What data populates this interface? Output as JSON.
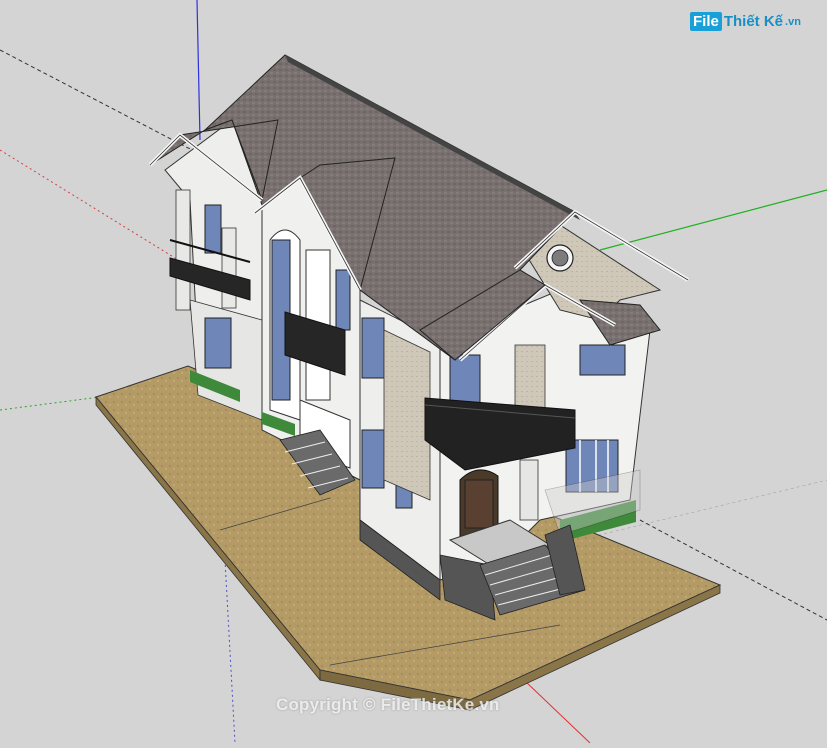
{
  "watermark": {
    "logo_mark": "File",
    "logo_text": "Thiết Kế",
    "logo_suffix": ".vn",
    "copyright": "Copyright © FileThietKe.vn"
  },
  "scene": {
    "subject": "two-storey-villa",
    "colors": {
      "background": "#d4d4d4",
      "roof": "#7a7070",
      "wall": "#f2f2f0",
      "stone": "#c9c2b4",
      "ground": "#b39a64",
      "glass": "#6f86b8",
      "railing": "#1e1e1e",
      "axis_red": "#e03030",
      "axis_green": "#20b020",
      "axis_blue": "#3030e0"
    }
  }
}
